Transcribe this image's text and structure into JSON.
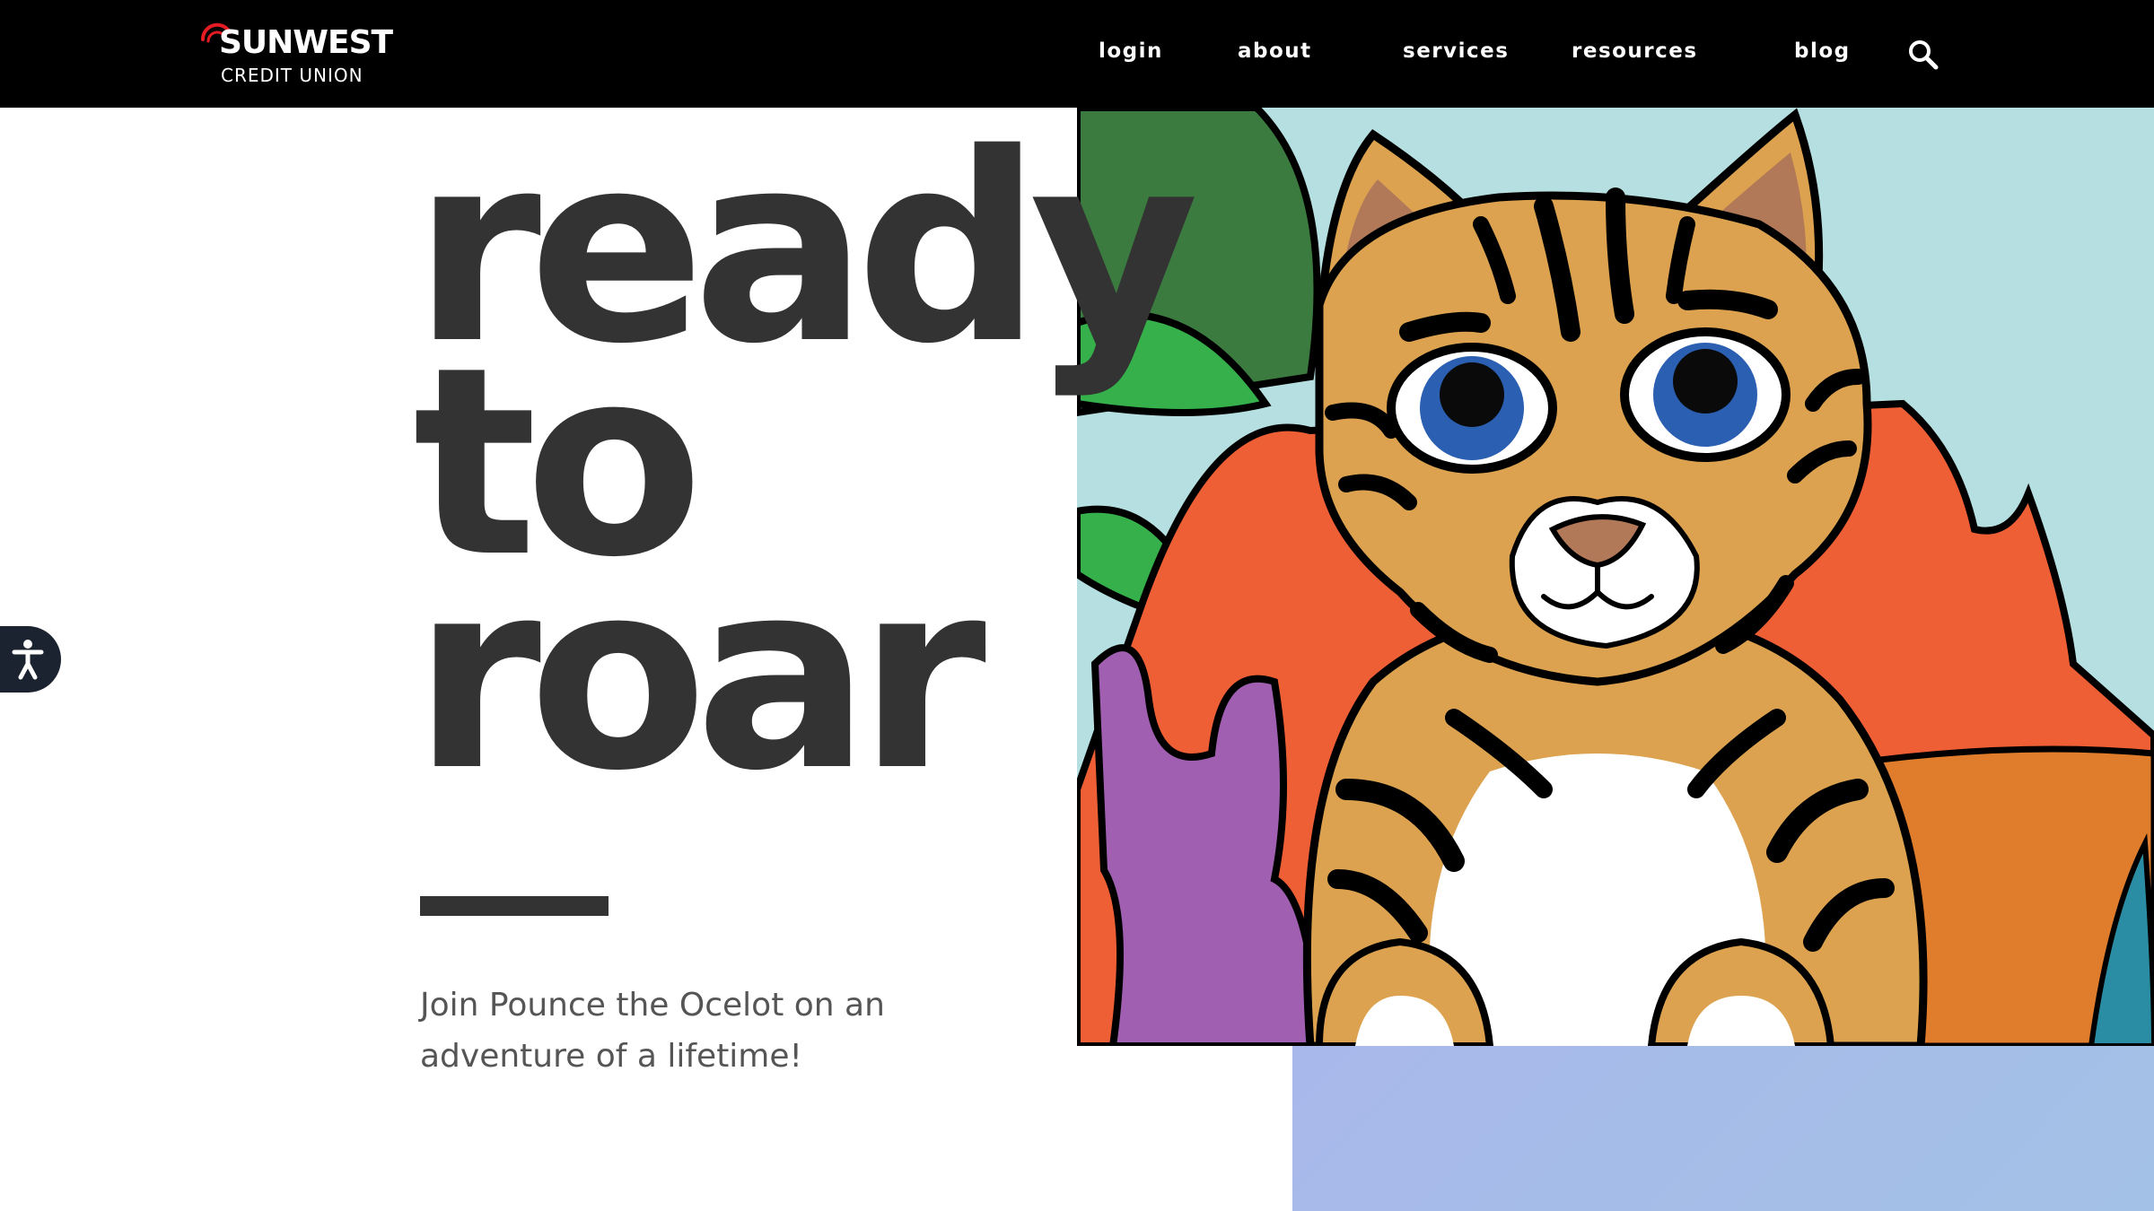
{
  "header": {
    "logo": {
      "wordmark": "SUNWEST",
      "subline": "CREDIT UNION",
      "icon": "sunwest-arc-logo",
      "accent_color": "#e31b23"
    },
    "nav": [
      {
        "label": "login"
      },
      {
        "label": "about"
      },
      {
        "label": "services"
      },
      {
        "label": "resources"
      },
      {
        "label": "blog"
      }
    ],
    "search_icon": "search-icon"
  },
  "hero": {
    "title_lines": [
      "ready",
      "to",
      "roar"
    ],
    "subtitle": "Join Pounce the Ocelot on an adventure of a lifetime!",
    "text_color": "#333333"
  },
  "illustration": {
    "subject": "ocelot-cartoon"
  },
  "accessibility": {
    "icon": "accessibility-icon"
  },
  "colors": {
    "header_bg": "#000000",
    "page_bg": "#ffffff",
    "block_blue": "#a6bde8"
  }
}
